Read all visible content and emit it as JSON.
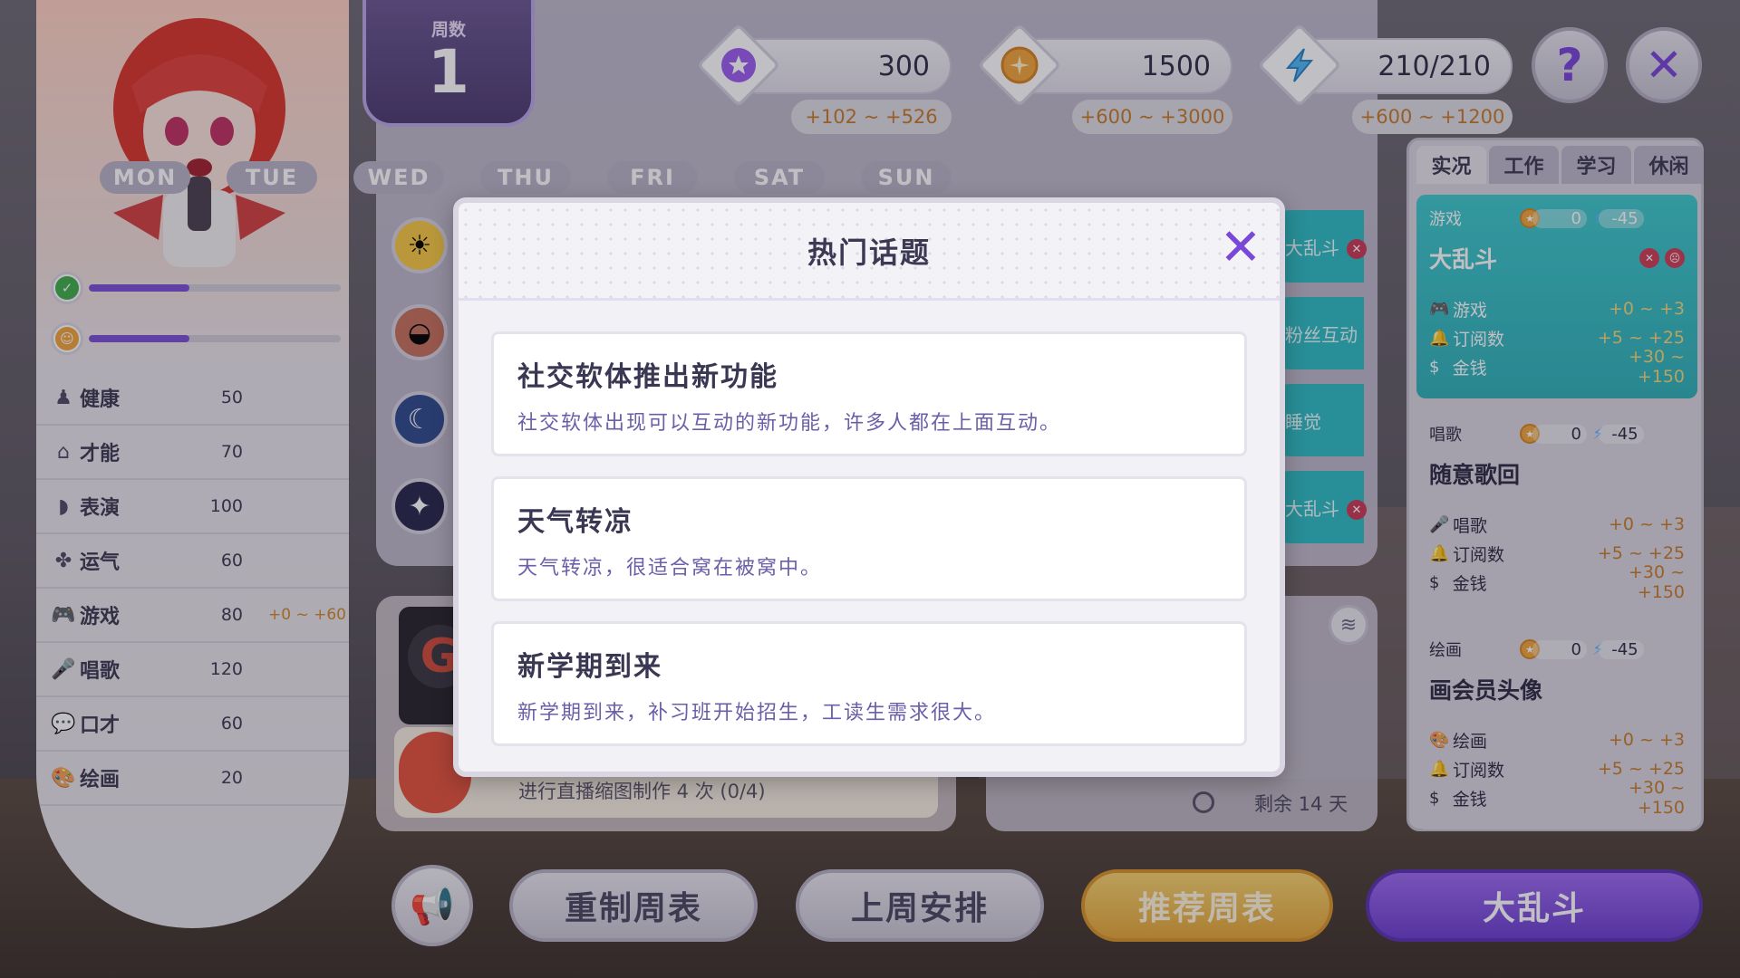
{
  "week": {
    "label": "周数",
    "number": "1"
  },
  "currencies": [
    {
      "icon": "subscriber-bell-icon",
      "value": "300",
      "range": "+102 ~ +526"
    },
    {
      "icon": "coin-icon",
      "value": "1500",
      "range": "+600 ~ +3000"
    },
    {
      "icon": "energy-bolt-icon",
      "value": "210/210",
      "range": "+600 ~ +1200"
    }
  ],
  "top_buttons": {
    "help": "?",
    "close": "✕"
  },
  "days": [
    "MON",
    "TUE",
    "WED",
    "THU",
    "FRI",
    "SAT",
    "SUN"
  ],
  "schedule_tiles": [
    "大乱斗",
    "粉丝互动",
    "睡觉",
    "大乱斗"
  ],
  "status_bars": [
    {
      "icon": "clipboard-check-icon",
      "fill": 0.4
    },
    {
      "icon": "smiley-face-icon",
      "fill": 0.4
    }
  ],
  "stats": [
    {
      "icon": "person-icon",
      "name": "健康",
      "value": "50",
      "extra": ""
    },
    {
      "icon": "talent-icon",
      "name": "才能",
      "value": "70",
      "extra": ""
    },
    {
      "icon": "mask-icon",
      "name": "表演",
      "value": "100",
      "extra": ""
    },
    {
      "icon": "clover-icon",
      "name": "运气",
      "value": "60",
      "extra": ""
    },
    {
      "icon": "gamepad-icon",
      "name": "游戏",
      "value": "80",
      "extra": "+0 ~ +60"
    },
    {
      "icon": "microphone-icon",
      "name": "唱歌",
      "value": "120",
      "extra": ""
    },
    {
      "icon": "speech-bubble-icon",
      "name": "口才",
      "value": "60",
      "extra": ""
    },
    {
      "icon": "palette-icon",
      "name": "绘画",
      "value": "20",
      "extra": ""
    }
  ],
  "task_panel": {
    "task_text": "进行直播缩图制作 4 次 (0/4)"
  },
  "info_panel": {
    "remaining": "剩余 14 天"
  },
  "right_tabs": [
    "实况",
    "工作",
    "学习",
    "休闲"
  ],
  "activities": [
    {
      "category": "游戏",
      "coin": "0",
      "energy": "-45",
      "title": "大乱斗",
      "rows": [
        {
          "icon": "gamepad-icon",
          "name": "游戏",
          "range": "+0 ~ +3"
        },
        {
          "icon": "subscriber-bell-icon",
          "name": "订阅数",
          "range": "+5 ~ +25"
        },
        {
          "icon": "money-icon",
          "name": "金钱",
          "range": "+30 ~ +150"
        }
      ]
    },
    {
      "category": "唱歌",
      "coin": "0",
      "energy": "-45",
      "title": "随意歌回",
      "rows": [
        {
          "icon": "microphone-icon",
          "name": "唱歌",
          "range": "+0 ~ +3"
        },
        {
          "icon": "subscriber-bell-icon",
          "name": "订阅数",
          "range": "+5 ~ +25"
        },
        {
          "icon": "money-icon",
          "name": "金钱",
          "range": "+30 ~ +150"
        }
      ]
    },
    {
      "category": "绘画",
      "coin": "0",
      "energy": "-45",
      "title": "画会员头像",
      "rows": [
        {
          "icon": "palette-icon",
          "name": "绘画",
          "range": "+0 ~ +3"
        },
        {
          "icon": "subscriber-bell-icon",
          "name": "订阅数",
          "range": "+5 ~ +25"
        },
        {
          "icon": "money-icon",
          "name": "金钱",
          "range": "+30 ~ +150"
        }
      ]
    }
  ],
  "bottom_buttons": {
    "reset": "重制周表",
    "last_week": "上周安排",
    "recommend": "推荐周表",
    "confirm": "大乱斗"
  },
  "modal": {
    "title": "热门话题",
    "topics": [
      {
        "title": "社交软体推出新功能",
        "desc": "社交软体出现可以互动的新功能，许多人都在上面互动。"
      },
      {
        "title": "天气转凉",
        "desc": "天气转凉，很适合窝在被窝中。"
      },
      {
        "title": "新学期到来",
        "desc": "新学期到来，补习班开始招生，工读生需求很大。"
      }
    ]
  },
  "colors": {
    "accent_purple": "#7a48d8",
    "teal_active": "#2eb1b8",
    "gold_button": "#e4a637",
    "range_orange": "#c57a2a"
  }
}
